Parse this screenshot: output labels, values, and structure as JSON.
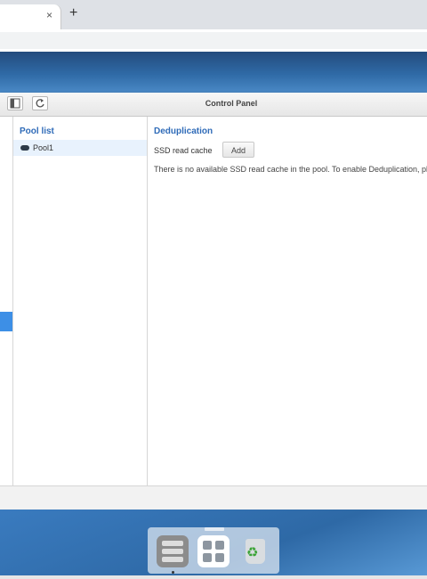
{
  "browser": {
    "tab_close_glyph": "×",
    "new_tab_glyph": "+"
  },
  "window": {
    "title": "Control Panel",
    "refresh_glyph": "C"
  },
  "pool_list": {
    "title": "Pool list",
    "items": [
      {
        "label": "Pool1",
        "icon": "disk-icon"
      }
    ]
  },
  "dedup": {
    "title": "Deduplication",
    "ssd_label": "SSD read cache",
    "add_label": "Add",
    "message": "There is no available SSD read cache in the pool. To enable Deduplication, pl"
  },
  "dock": {
    "icons": [
      "storage-manager-icon",
      "main-menu-icon",
      "recycle-bin-icon"
    ],
    "recycle_glyph": "♻"
  },
  "colors": {
    "accent": "#2f6bb8",
    "selection": "#e8f2fd",
    "desktop": "#2f6aa6"
  }
}
